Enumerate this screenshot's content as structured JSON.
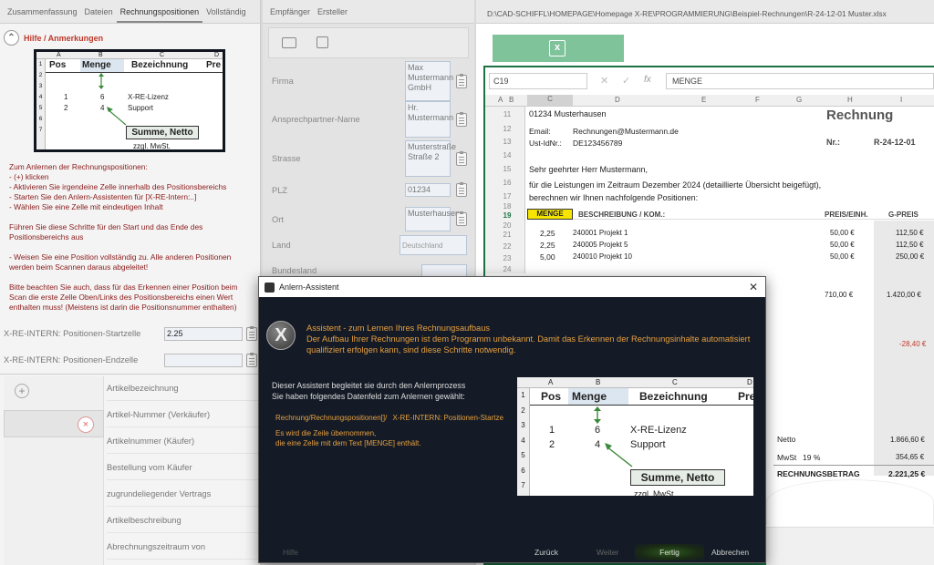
{
  "left": {
    "tabs": [
      "Zusammenfassung",
      "Dateien",
      "Rechnungspositionen",
      "Vollständig"
    ],
    "hilfe_label": "Hilfe / Anmerkungen",
    "image": {
      "cols": [
        "A",
        "B",
        "C",
        "D"
      ],
      "header": [
        "Pos",
        "Menge",
        "Bezeichnung",
        "Pre"
      ],
      "rows": [
        [
          "1",
          "6",
          "X-RE-Lizenz"
        ],
        [
          "2",
          "4",
          "Support"
        ]
      ],
      "summe": "Summe, Netto",
      "zzgl": "zzgl. MwSt."
    },
    "instructions": [
      "Zum Anlernen der Rechnungspositionen:",
      "- (+) klicken",
      "- Aktivieren Sie irgendeine Zelle innerhalb des Positionsbereichs",
      "- Starten Sie den Anlern-Assistenten für [X-RE-Intern:..]",
      "- Wählen Sie eine Zelle mit eindeutigen Inhalt",
      "",
      "Führen Sie diese Schritte für den Start und das Ende des Positionsbereichs aus",
      "",
      "- Weisen Sie eine Position vollständig zu. Alle anderen Positionen werden beim Scannen daraus abgeleitet!",
      "",
      "Bitte beachten Sie auch, dass für das Erkennen einer Position beim Scan die erste Zelle Oben/Links des Positionsbereichs einen Wert enthalten muss! (Meistens ist darin die Positionsnummer enthalten)"
    ],
    "start_label": "X-RE-INTERN: Positionen-Startzelle",
    "start_value": "2.25",
    "end_label": "X-RE-INTERN: Positionen-Endzelle",
    "end_value": "",
    "article_fields": [
      "Artikelbezeichnung",
      "Artikel-Nummer (Verkäufer)",
      "Artikelnummer (Käufer)",
      "Bestellung vom Käufer",
      "zugrundeliegender Vertrags",
      "Artikelbeschreibung",
      "Abrechnungszeitraum von"
    ]
  },
  "mid": {
    "tabs": [
      "Empfänger",
      "Ersteller"
    ],
    "fields": [
      {
        "label": "Firma",
        "value": "Max Mustermann GmbH"
      },
      {
        "label": "Ansprechpartner-Name",
        "value": "Hr. Mustermann"
      },
      {
        "label": "Strasse",
        "value": "Musterstraße Straße 2"
      },
      {
        "label": "PLZ",
        "value": "01234"
      },
      {
        "label": "Ort",
        "value": "Musterhausen"
      },
      {
        "label": "Land",
        "value": "Deutschland"
      },
      {
        "label": "Bundesland",
        "value": ""
      }
    ]
  },
  "right": {
    "path": "D:\\CAD-SCHIFFL\\HOMEPAGE\\Homepage X-RE\\PROGRAMMIERUNG\\Beispiel-Rechnungen\\R-24-12-01 Muster.xlsx",
    "cell_ref": "C19",
    "formula": "MENGE",
    "cols": [
      "A",
      "B",
      "C",
      "D",
      "E",
      "F",
      "G",
      "H",
      "I"
    ],
    "rows": [
      "11",
      "12",
      "13",
      "14",
      "15",
      "16",
      "17",
      "18",
      "19",
      "20",
      "21",
      "22",
      "23",
      "24"
    ],
    "plz_ort": "01234      Musterhausen",
    "email_lbl": "Email:",
    "email": "Rechnungen@Mustermann.de",
    "ust_lbl": "Ust-IdNr.:",
    "ust": "DE123456789",
    "rechnung": "Rechnung",
    "nr_lbl": "Nr.:",
    "nr": "R-24-12-01",
    "greet": "Sehr geehrter Herr Mustermann,",
    "text1": "für die Leistungen im Zeitraum Dezember 2024 (detaillierte Übersicht beigefügt),",
    "text2": "berechnen wir Ihnen nachfolgende Positionen:",
    "th_menge": "MENGE",
    "th_besch": "BESCHREIBUNG / KOM.:",
    "th_preis": "PREIS/EINH.",
    "th_gpreis": "G-PREIS",
    "items": [
      {
        "menge": "2,25",
        "besch": "240001 Projekt 1",
        "preis": "50,00 €",
        "gpreis": "112,50 €"
      },
      {
        "menge": "2,25",
        "besch": "240005 Projekt 5",
        "preis": "50,00 €",
        "gpreis": "112,50 €"
      },
      {
        "menge": "5,00",
        "besch": "240010 Projekt 10",
        "preis": "50,00 €",
        "gpreis": "250,00 €"
      }
    ],
    "extra_preis": "710,00 €",
    "extra_gpreis": "1.420,00 €",
    "neg": "-28,40 €",
    "netto_lbl": "Netto",
    "netto": "1.866,60 €",
    "mwst_lbl": "MwSt",
    "mwst_pct": "19 %",
    "mwst": "354,65 €",
    "total_lbl": "RECHNUNGSBETRAG",
    "total": "2.221,25 €"
  },
  "dialog": {
    "title": "Anlern-Assistent",
    "head1": "Assistent - zum Lernen Ihres Rechnungsaufbaus",
    "head2": "Der Aufbau Ihrer Rechnungen ist dem Programm unbekannt. Damit das Erkennen der Rechnungsinhalte automatisiert qualifiziert erfolgen kann, sind diese Schritte notwendig.",
    "body1": "Dieser Assistent begleitet sie durch den Anlernprozess",
    "body2": "Sie haben folgendes Datenfeld zum Anlernen gewählt:",
    "field_path": "Rechnung/Rechnungspositionen[]/",
    "field_name": "X-RE-INTERN: Positionen-Startze",
    "note1": "Es wird die Zeile übernommen,",
    "note2": "die eine Zelle mit dem Text [MENGE] enthält.",
    "buttons": {
      "hilfe": "Hilfe",
      "zurueck": "Zurück",
      "weiter": "Weiter",
      "fertig": "Fertig",
      "abbrechen": "Abbrechen"
    }
  },
  "colors": {
    "accent_yellow": "#f5e500",
    "dialog_bg": "#141b26",
    "dialog_text": "#e8a040",
    "excel_green": "#1e7145",
    "fertig_bg": "#1f3d1f"
  }
}
